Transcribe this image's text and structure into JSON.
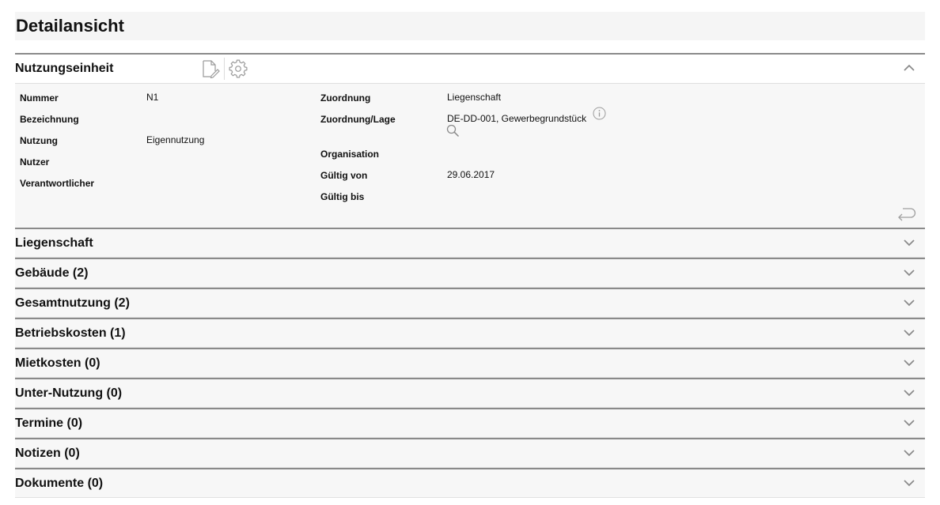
{
  "page": {
    "title": "Detailansicht"
  },
  "main_section": {
    "title": "Nutzungseinheit",
    "tools": [
      {
        "name": "edit-document-icon"
      },
      {
        "name": "settings-gear-icon"
      }
    ],
    "left_fields": [
      {
        "label": "Nummer",
        "value": "N1"
      },
      {
        "label": "Bezeichnung",
        "value": ""
      },
      {
        "label": "Nutzung",
        "value": "Eigennutzung"
      },
      {
        "label": "Nutzer",
        "value": ""
      },
      {
        "label": "Verantwortlicher",
        "value": ""
      }
    ],
    "right_fields": [
      {
        "label": "Zuordnung",
        "value": "Liegenschaft"
      },
      {
        "label": "Zuordnung/Lage",
        "value": "DE-DD-001, Gewerbegrundstück"
      },
      {
        "label": "Organisation",
        "value": ""
      },
      {
        "label": "Gültig von",
        "value": "29.06.2017"
      },
      {
        "label": "Gültig bis",
        "value": ""
      }
    ],
    "collapse_icon": "chevron-up-icon",
    "info_icon": "info-icon",
    "search_icon": "search-icon",
    "back_icon": "return-arrow-icon"
  },
  "sections": [
    {
      "title": "Liegenschaft",
      "icon": "chevron-down-icon"
    },
    {
      "title": "Gebäude (2)",
      "icon": "chevron-down-icon"
    },
    {
      "title": "Gesamtnutzung (2)",
      "icon": "chevron-down-icon"
    },
    {
      "title": "Betriebskosten (1)",
      "icon": "chevron-down-icon"
    },
    {
      "title": "Mietkosten (0)",
      "icon": "chevron-down-icon"
    },
    {
      "title": "Unter-Nutzung (0)",
      "icon": "chevron-down-icon"
    },
    {
      "title": "Termine (0)",
      "icon": "chevron-down-icon"
    },
    {
      "title": "Notizen (0)",
      "icon": "chevron-down-icon"
    },
    {
      "title": "Dokumente (0)",
      "icon": "chevron-down-icon"
    }
  ],
  "colors": {
    "rule": "#8a8a8a",
    "panel_bg": "#f7f7f7",
    "icon_gray": "#9a9a9a"
  }
}
